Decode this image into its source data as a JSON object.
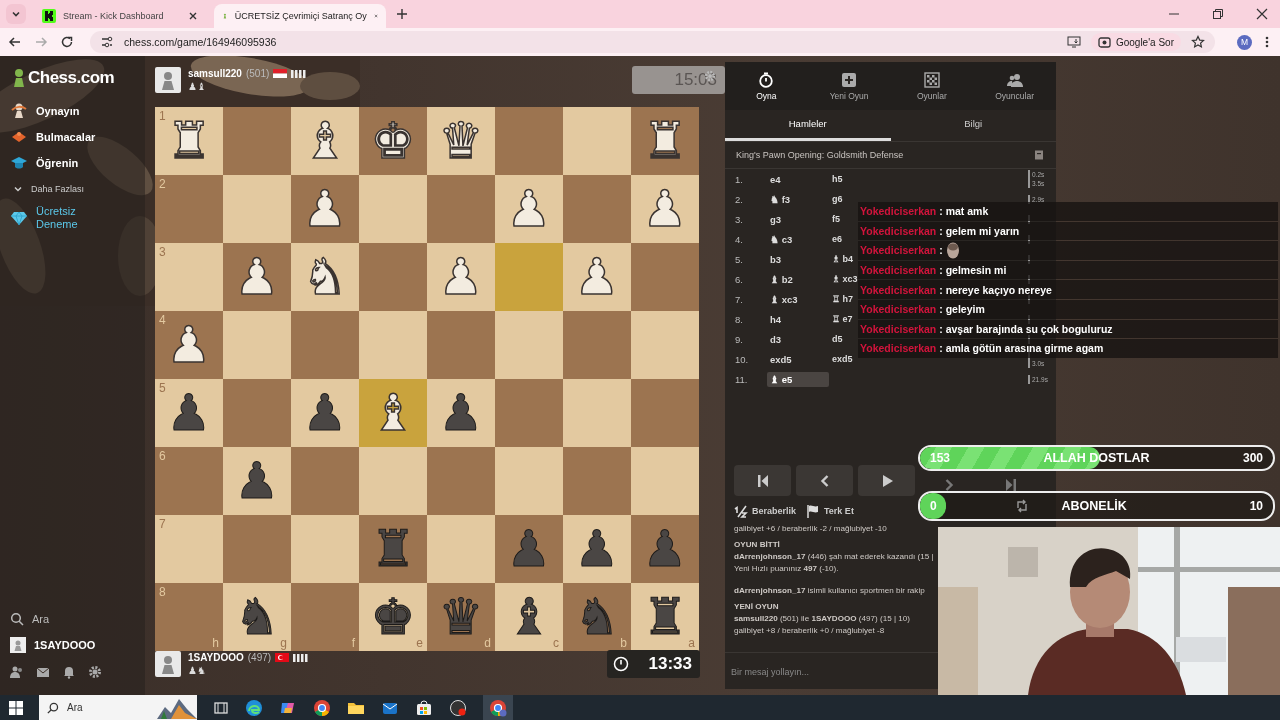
{
  "browser": {
    "tabs": [
      {
        "title": "Stream - Kick Dashboard",
        "selected": false,
        "kind": "kick"
      },
      {
        "title": "ÜCRETSİZ Çevrimiçi Satranç Oy",
        "selected": true,
        "kind": "chess"
      }
    ],
    "url": "chess.com/game/164946095936",
    "forward_disabled": true,
    "ask_button": "Google'a Sor",
    "profile": "M"
  },
  "sidebar": {
    "logo": "Chess.com",
    "items": [
      {
        "label": "Oynayın",
        "kind": "play"
      },
      {
        "label": "Bulmacalar",
        "kind": "puzzles"
      },
      {
        "label": "Öğrenin",
        "kind": "learn"
      },
      {
        "label": "Daha Fazlası",
        "kind": "more"
      },
      {
        "label": "Ücretsiz Deneme",
        "kind": "trial"
      }
    ],
    "search": "Ara",
    "user": "1SAYDOOO"
  },
  "top_player": {
    "name": "samsull220",
    "rating": "(501)",
    "flag": {
      "kind": "id"
    },
    "captured": "♟♝",
    "clock": "15:03",
    "active": false
  },
  "bottom_player": {
    "name": "1SAYDOOO",
    "rating": "(497)",
    "flag": {
      "kind": "tr"
    },
    "captured": "♟♞",
    "clock": "13:33",
    "active": true
  },
  "board": {
    "ranks": [
      "1",
      "2",
      "3",
      "4",
      "5",
      "6",
      "7",
      "8"
    ],
    "files": [
      "h",
      "g",
      "f",
      "e",
      "d",
      "c",
      "b",
      "a"
    ],
    "rows": [
      [
        {
          "piece": "♜",
          "kind": "white",
          "highlighted": false
        },
        {
          "highlighted": false
        },
        {
          "piece": "♝",
          "kind": "white",
          "highlighted": false
        },
        {
          "piece": "♚",
          "kind": "white",
          "highlighted": false
        },
        {
          "piece": "♛",
          "kind": "white",
          "highlighted": false
        },
        {
          "highlighted": false
        },
        {
          "highlighted": false
        },
        {
          "piece": "♜",
          "kind": "white",
          "highlighted": false
        }
      ],
      [
        {
          "highlighted": false
        },
        {
          "highlighted": false
        },
        {
          "piece": "♟",
          "kind": "white",
          "highlighted": false
        },
        {
          "highlighted": false
        },
        {
          "highlighted": false
        },
        {
          "piece": "♟",
          "kind": "white",
          "highlighted": false
        },
        {
          "highlighted": false
        },
        {
          "piece": "♟",
          "kind": "white",
          "highlighted": false
        }
      ],
      [
        {
          "highlighted": false
        },
        {
          "piece": "♟",
          "kind": "white",
          "highlighted": false
        },
        {
          "piece": "♞",
          "kind": "white",
          "highlighted": false
        },
        {
          "highlighted": false
        },
        {
          "piece": "♟",
          "kind": "white",
          "highlighted": false
        },
        {
          "highlighted": true
        },
        {
          "piece": "♟",
          "kind": "white",
          "highlighted": false
        },
        {
          "highlighted": false
        }
      ],
      [
        {
          "piece": "♟",
          "kind": "white",
          "highlighted": false
        },
        {
          "highlighted": false
        },
        {
          "highlighted": false
        },
        {
          "highlighted": false
        },
        {
          "highlighted": false
        },
        {
          "highlighted": false
        },
        {
          "highlighted": false
        },
        {
          "highlighted": false
        }
      ],
      [
        {
          "piece": "♟",
          "kind": "black",
          "highlighted": false
        },
        {
          "highlighted": false
        },
        {
          "piece": "♟",
          "kind": "black",
          "highlighted": false
        },
        {
          "piece": "♝",
          "kind": "white",
          "highlighted": true
        },
        {
          "piece": "♟",
          "kind": "black",
          "highlighted": false
        },
        {
          "highlighted": false
        },
        {
          "highlighted": false
        },
        {
          "highlighted": false
        }
      ],
      [
        {
          "highlighted": false
        },
        {
          "piece": "♟",
          "kind": "black",
          "highlighted": false
        },
        {
          "highlighted": false
        },
        {
          "highlighted": false
        },
        {
          "highlighted": false
        },
        {
          "highlighted": false
        },
        {
          "highlighted": false
        },
        {
          "highlighted": false
        }
      ],
      [
        {
          "highlighted": false
        },
        {
          "highlighted": false
        },
        {
          "highlighted": false
        },
        {
          "piece": "♜",
          "kind": "black",
          "highlighted": false
        },
        {
          "highlighted": false
        },
        {
          "piece": "♟",
          "kind": "black",
          "highlighted": false
        },
        {
          "piece": "♟",
          "kind": "black",
          "highlighted": false
        },
        {
          "piece": "♟",
          "kind": "black",
          "highlighted": false
        }
      ],
      [
        {
          "highlighted": false
        },
        {
          "piece": "♞",
          "kind": "black",
          "highlighted": false
        },
        {
          "highlighted": false
        },
        {
          "piece": "♚",
          "kind": "black",
          "highlighted": false
        },
        {
          "piece": "♛",
          "kind": "black",
          "highlighted": false
        },
        {
          "piece": "♝",
          "kind": "black",
          "highlighted": false
        },
        {
          "piece": "♞",
          "kind": "black",
          "highlighted": false
        },
        {
          "piece": "♜",
          "kind": "black",
          "highlighted": false
        }
      ]
    ]
  },
  "panel": {
    "nav": [
      {
        "label": "Oyna",
        "kind": "clock",
        "selected": true
      },
      {
        "label": "Yeni Oyun",
        "kind": "plus",
        "selected": false
      },
      {
        "label": "Oyunlar",
        "kind": "grid",
        "selected": false
      },
      {
        "label": "Oyuncular",
        "kind": "people",
        "selected": false
      }
    ],
    "tabs": [
      {
        "label": "Hamleler",
        "selected": true
      },
      {
        "label": "Bilgi",
        "selected": false
      }
    ],
    "opening": "King's Pawn Opening: Goldsmith Defense",
    "moves": [
      {
        "number": "1.",
        "white": {
          "san": "e4",
          "selected": false
        },
        "black": {
          "san": "h5",
          "selected": false
        },
        "time_white": "0.2s",
        "time_black": "3.5s"
      },
      {
        "number": "2.",
        "white": {
          "san": "♞ f3",
          "selected": false
        },
        "black": {
          "san": "g6",
          "selected": false
        },
        "time_white": "2.9s"
      },
      {
        "number": "3.",
        "white": {
          "san": "g3",
          "selected": false
        },
        "black": {
          "san": "f5",
          "selected": false
        }
      },
      {
        "number": "4.",
        "white": {
          "san": "♞ c3",
          "selected": false
        },
        "black": {
          "san": "e6",
          "selected": false
        }
      },
      {
        "number": "5.",
        "white": {
          "san": "b3",
          "selected": false
        },
        "black": {
          "san": "♗ b4",
          "selected": false
        }
      },
      {
        "number": "6.",
        "white": {
          "san": "♝ b2",
          "selected": false
        },
        "black": {
          "san": "♗ xc3",
          "selected": false
        }
      },
      {
        "number": "7.",
        "white": {
          "san": "♝ xc3",
          "selected": false
        },
        "black": {
          "san": "♖ h7",
          "selected": false
        }
      },
      {
        "number": "8.",
        "white": {
          "san": "h4",
          "selected": false
        },
        "black": {
          "san": "♖ e7",
          "selected": false
        }
      },
      {
        "number": "9.",
        "white": {
          "san": "d3",
          "selected": false
        },
        "black": {
          "san": "d5",
          "selected": false
        }
      },
      {
        "number": "10.",
        "white": {
          "san": "exd5",
          "selected": false
        },
        "black": {
          "san": "exd5",
          "selected": false
        },
        "time_black": "3.0s"
      },
      {
        "number": "11.",
        "white": {
          "san": "♝ e5",
          "selected": true
        },
        "time_white": "21.9s"
      }
    ],
    "controls": [
      {
        "kind": "first",
        "disabled": false
      },
      {
        "kind": "prev",
        "disabled": false
      },
      {
        "kind": "play",
        "disabled": false
      },
      {
        "kind": "next",
        "disabled": true
      },
      {
        "kind": "last",
        "disabled": true
      }
    ],
    "actions": [
      {
        "label": "Beraberlik",
        "kind": "draw"
      },
      {
        "label": "Terk Et",
        "kind": "resign"
      }
    ],
    "log": [
      {
        "kind": "text",
        "text": "galibiyet +6 / beraberlik -2 / mağlubiyet -10"
      },
      {
        "kind": "heading",
        "text": "OYUN BİTTİ"
      },
      {
        "kind": "text",
        "text": "**dArrenjohnson_17** (446) şah mat ederek kazandı (15 |"
      },
      {
        "kind": "text",
        "text": "Yeni Hızlı puanınız **497** (-10)."
      },
      {
        "kind": "notice",
        "text": "**dArrenjohnson_17** isimli kullanıcı sportmen bir rakip"
      },
      {
        "kind": "heading",
        "text": "YENİ OYUN"
      },
      {
        "kind": "text",
        "text": "**samsull220** (501) ile **1SAYDOOO** (497) (15 | 10)"
      },
      {
        "kind": "text",
        "text": "galibiyet +8 / beraberlik +0 / mağlubiyet -8"
      }
    ],
    "message_placeholder": "Bir mesaj yollayın..."
  },
  "stream_chat": [
    {
      "user": "Yokediciserkan",
      "kind": "text",
      "text": ": mat amk"
    },
    {
      "user": "Yokediciserkan",
      "kind": "text",
      "text": ": gelem mi yarın"
    },
    {
      "user": "Yokediciserkan",
      "kind": "sticker",
      "text": ":"
    },
    {
      "user": "Yokediciserkan",
      "kind": "text",
      "text": ": gelmesin mi"
    },
    {
      "user": "Yokediciserkan",
      "kind": "text",
      "text": ": nereye kaçıyo nereye"
    },
    {
      "user": "Yokediciserkan",
      "kind": "text",
      "text": ": geleyim"
    },
    {
      "user": "Yokediciserkan",
      "kind": "text",
      "text": ": avşar barajında su çok boguluruz"
    },
    {
      "user": "Yokediciserkan",
      "kind": "text",
      "text": ": amla götün arasına girme agam"
    }
  ],
  "goals": [
    {
      "current": "153",
      "title": "ALLAH DOSTLAR",
      "target": "300",
      "level": 0.51,
      "kind": "follow"
    },
    {
      "current": "0",
      "title": "ABONELİK",
      "target": "10",
      "level": 0,
      "kind": "sub"
    }
  ],
  "taskbar": {
    "search": "Ara"
  }
}
